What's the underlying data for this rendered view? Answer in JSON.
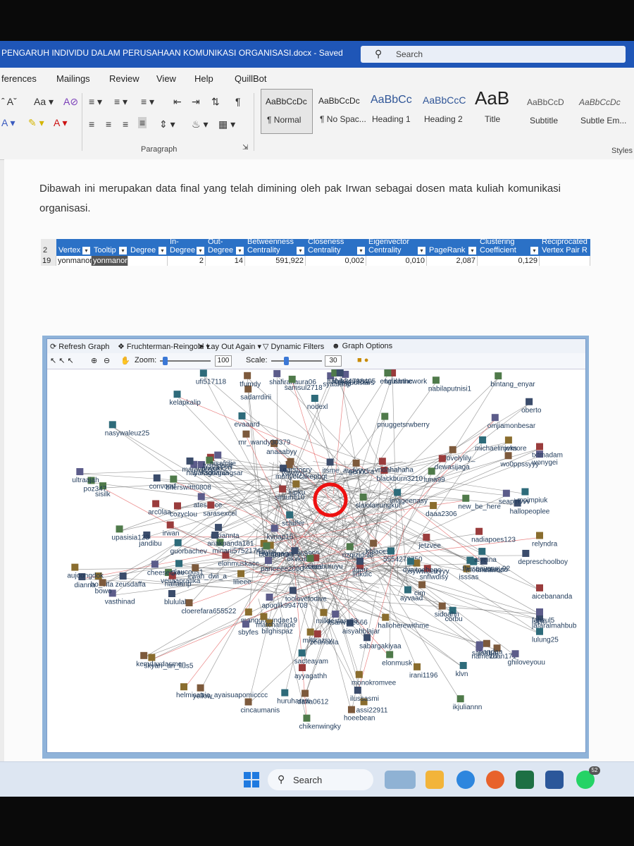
{
  "window": {
    "doc_title": "PENGARUH INDIVIDU DALAM PERUSAHAAN KOMUNIKASI ORGANISASI.docx",
    "saved_status": "Saved",
    "search_placeholder": "Search"
  },
  "menu": [
    "ferences",
    "Mailings",
    "Review",
    "View",
    "Help",
    "QuillBot"
  ],
  "ribbon": {
    "paragraph_label": "Paragraph",
    "styles_label": "Styles",
    "styles": [
      {
        "sample": "AaBbCcDc",
        "name": "¶ Normal",
        "selected": true
      },
      {
        "sample": "AaBbCcDc",
        "name": "¶ No Spac...",
        "selected": false
      },
      {
        "sample": "AaBbCc",
        "name": "Heading 1",
        "selected": false
      },
      {
        "sample": "AaBbCcC",
        "name": "Heading 2",
        "selected": false
      },
      {
        "sample": "AaB",
        "name": "Title",
        "selected": false
      },
      {
        "sample": "AaBbCcD",
        "name": "Subtitle",
        "selected": false
      },
      {
        "sample": "AaBbCcDc",
        "name": "Subtle Em...",
        "selected": false
      }
    ]
  },
  "document": {
    "paragraph": "Dibawah ini merupakan data final yang telah dimining oleh pak Irwan sebagai dosen mata kuliah komunikasi organisasi."
  },
  "table": {
    "headers": [
      "Vertex",
      "Tooltip",
      "Degree",
      "In-Degree",
      "Out-Degree",
      "Betweenness Centrality",
      "Closeness Centrality",
      "Eigenvector Centrality",
      "PageRank",
      "Clustering Coefficient",
      "Reciprocated Vertex Pair R"
    ],
    "header_row_num": "2",
    "data_row_num": "19",
    "row": [
      "yonmanor",
      "yonmanor",
      "",
      "2",
      "14",
      "591,922",
      "0,002",
      "0,010",
      "2,087",
      "0,129",
      ""
    ]
  },
  "nodexl": {
    "toolbar": {
      "refresh": "Refresh Graph",
      "layout": "Fruchterman-Reingold",
      "layout_again": "Lay Out Again",
      "dynamic_filters": "Dynamic Filters",
      "graph_options": "Graph Options",
      "zoom_label": "Zoom:",
      "zoom_value": "100",
      "scale_label": "Scale:",
      "scale_value": "30"
    },
    "labels": [
      "jandibu",
      "cim",
      "vellaapratika",
      "isem",
      "baksowgangsar",
      "huruharaw",
      "lupku",
      "rifkiannta",
      "yawwyc",
      "biterswittt0808",
      "linkdic",
      "wonygei",
      "corbu",
      "daaa2306",
      "blululala",
      "anaaabyy",
      "ikjuliannn",
      "elonmuskacc",
      "atesauce",
      "klvn",
      "manggosundae19",
      "jafaralmahbub",
      "hoeebean",
      "minarii57521741",
      "fvsustanti",
      "turquoistars",
      "ayvaad",
      "hiayuk",
      "lawstudad",
      "sadarrdirii",
      "new_be_here",
      "nailaanp",
      "vasthinad",
      "glaucous1",
      "milktestaro08",
      "itsme_audyyy",
      "daffa0612",
      "bintang_enyar",
      "txtmadam",
      "syaaluap",
      "schiffer",
      "bilghispaz",
      "sabargakiyaa",
      "tfumdy",
      "chikenwingky",
      "nadiapoes123",
      "nayaraghania",
      "lulung25",
      "ho_vita",
      "mariwposse",
      "zdan171",
      "luna99",
      "jetzvee",
      "shafiranaura06",
      "ufi517118",
      "assi22911",
      "itgarr",
      "khlaces",
      "sisilk",
      "blackburn3210",
      "kvnap15",
      "sacteayam",
      "isssas",
      "aisyahblajar",
      "gerindra",
      "rizqizidni8",
      "simuhil10",
      "paneeee2000",
      "guorbachev",
      "relyndra",
      "zeusdaffa",
      "yellow",
      "samsul2718",
      "zeunoola",
      "fahzul5",
      "5554272750",
      "halloherewithme",
      "depreschoolboy",
      "irwan_dwi_a",
      "poz347",
      "cozyclou",
      "ghiloveyouu",
      "evaaard",
      "rovmore",
      "dianna",
      "lovelylily_",
      "upasisia123",
      "twulannc",
      "ultraajah",
      "kelapkalip",
      "ranggago2969995",
      "hallopeoplee",
      "mr_wandy30379",
      "habib34798405",
      "irwan",
      "omjiamonbesar",
      "moondawnr",
      "aujoongdok",
      "monyetcakepbgt",
      "earstocry",
      "elonmusk",
      "cemburuyu",
      "seapinvvv",
      "alveina",
      "irani1196",
      "ilussasmi",
      "cincaumanis",
      "unyukk20",
      "vndahahaha",
      "sbyfes",
      "michaelinjeks",
      "sywwberryyy",
      "anakpanda161",
      "cloerefara655522",
      "kaaaa",
      "aicebananda",
      "cheeseckee",
      "imageenasy",
      "lilieee",
      "okvkul",
      "pandaa",
      "slaiolairungkut",
      "sarasexcel",
      "apoglik994708",
      "nodexl",
      "monokromvee",
      "oberto",
      "kemdaxdasmen",
      "pnuggetsrwberry",
      "snflwdisy",
      "namel07",
      "nasywaleuz25",
      "mittkazsy",
      "toolovetodive",
      "wo0ppssyyy",
      "englishthework",
      "ayyagathh",
      "salsatra",
      "mpimpiuk",
      "matchafrape",
      "convomf",
      "sidoahn",
      "nabilaputnisi1",
      "arc0laa",
      "nisafrilie",
      "dyaitoebego",
      "skyarr_an_lius5",
      "lilukkenzzzz",
      "bowo",
      "bangerrran",
      "dewasijaga",
      "itsarivate666",
      "theseavans_92",
      "helmisatria_ayaisuapomicccc"
    ]
  }
}
